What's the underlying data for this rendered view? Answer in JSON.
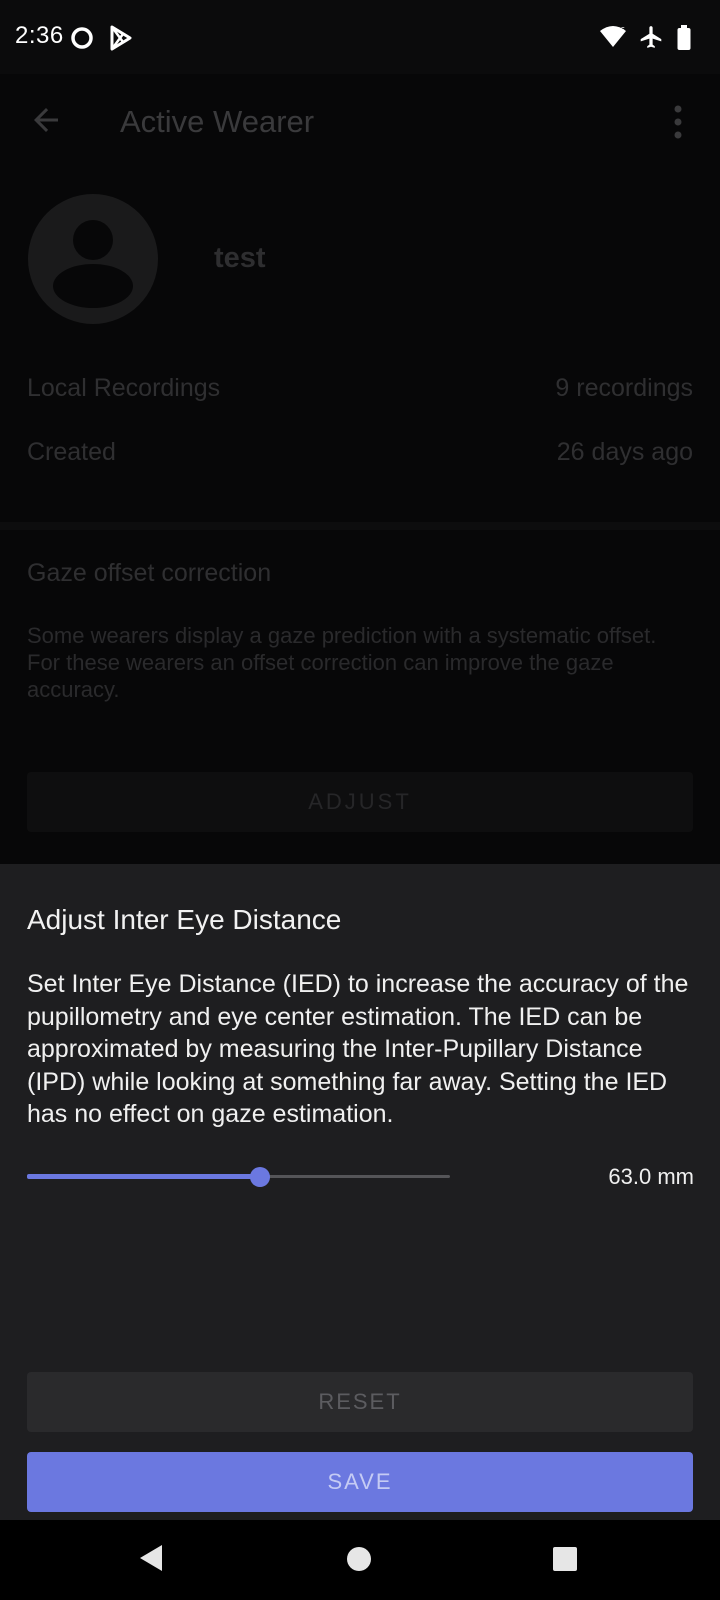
{
  "status_bar": {
    "time": "2:36",
    "icons": [
      "circle-notification-icon",
      "play-store-icon",
      "wifi-icon",
      "airplane-mode-icon",
      "battery-icon"
    ]
  },
  "app_bar": {
    "title": "Active Wearer",
    "back_icon": "arrow-back-icon",
    "menu_icon": "more-vert-icon"
  },
  "wearer": {
    "name": "test",
    "avatar_icon": "account-circle-icon",
    "info": [
      {
        "label": "Local Recordings",
        "value": "9 recordings"
      },
      {
        "label": "Created",
        "value": "26 days ago"
      }
    ]
  },
  "gaze_offset": {
    "title": "Gaze offset correction",
    "description": "Some wearers display a gaze prediction with a systematic offset. For these wearers an offset correction can improve the gaze accuracy.",
    "adjust_label": "ADJUST"
  },
  "sheet": {
    "title": "Adjust Inter Eye Distance",
    "description": "Set Inter Eye Distance (IED) to increase the accuracy of the pupillometry and eye center estimation. The IED can be approximated by measuring the Inter-Pupillary Distance (IPD) while looking at something far away. Setting the IED has no effect on gaze estimation.",
    "slider_fraction": 0.55,
    "value_label": "63.0 mm",
    "reset_label": "RESET",
    "save_label": "SAVE",
    "accent_color": "#6b78e0"
  },
  "nav_bar": {
    "icons": [
      "nav-back-icon",
      "nav-home-icon",
      "nav-recents-icon"
    ]
  }
}
